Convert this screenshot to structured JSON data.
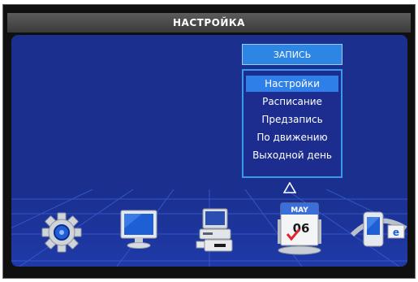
{
  "header": {
    "title": "НАСТРОЙКА"
  },
  "submenu": {
    "title": "ЗАПИСЬ",
    "items": [
      {
        "label": "Настройки",
        "selected": true
      },
      {
        "label": "Расписание",
        "selected": false
      },
      {
        "label": "Предзапись",
        "selected": false
      },
      {
        "label": "По движению",
        "selected": false
      },
      {
        "label": "Выходной день",
        "selected": false
      }
    ]
  },
  "calendar": {
    "month": "MAY",
    "day": "06"
  },
  "dock": {
    "icons": [
      "gear-icon",
      "monitor-icon",
      "computer-icon",
      "calendar-icon",
      "network-icon"
    ],
    "selected_index": 3
  },
  "colors": {
    "panel": "#1a2f8e",
    "menu_accent": "#2d86e3",
    "selection": "#2f7fe8"
  }
}
